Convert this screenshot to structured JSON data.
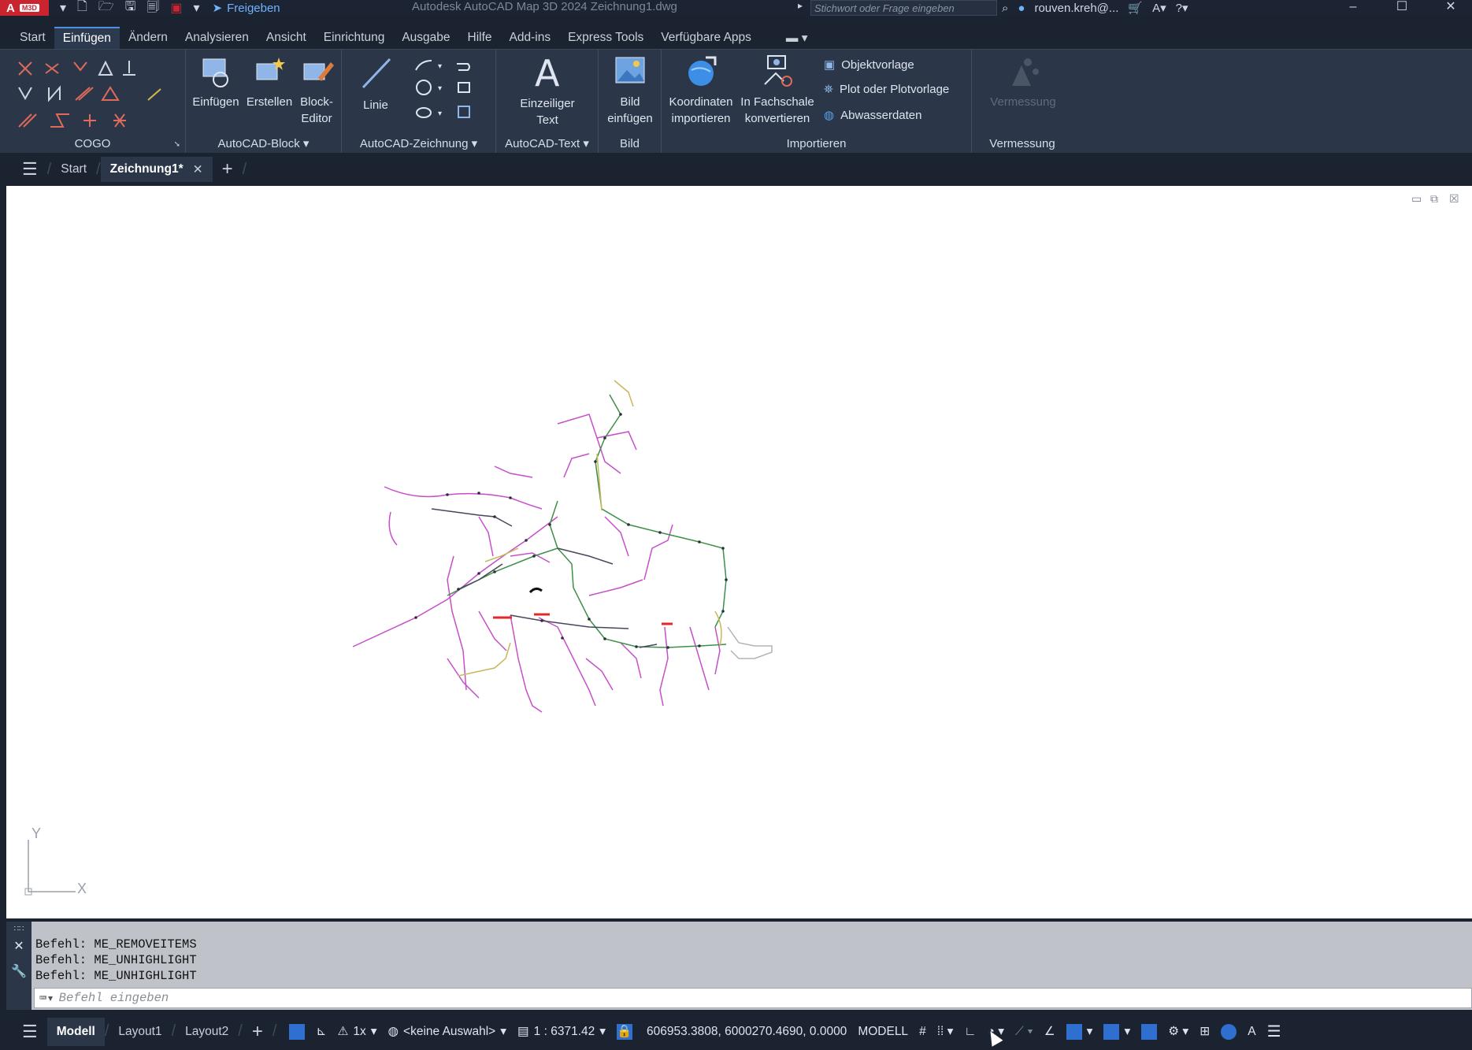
{
  "titlebar": {
    "logo_text": "A",
    "logo_badge": "M3D",
    "share_label": "Freigeben",
    "window_title": "Autodesk AutoCAD Map 3D 2024  Zeichnung1.dwg",
    "search_placeholder": "Stichwort oder Frage eingeben",
    "user": "rouven.kreh@..."
  },
  "menu": {
    "tabs": [
      "Start",
      "Einfügen",
      "Ändern",
      "Analysieren",
      "Ansicht",
      "Einrichtung",
      "Ausgabe",
      "Hilfe",
      "Add-ins",
      "Express Tools",
      "Verfügbare Apps"
    ],
    "active": "Einfügen"
  },
  "ribbon": {
    "cogo": {
      "title": "COGO"
    },
    "block": {
      "title": "AutoCAD-Block",
      "einfuegen": "Einfügen",
      "erstellen": "Erstellen",
      "block": "Block-",
      "editor": "Editor"
    },
    "zeichnung": {
      "title": "AutoCAD-Zeichnung",
      "linie": "Linie"
    },
    "text": {
      "title": "AutoCAD-Text",
      "einzeiliger": "Einzeiliger",
      "text": "Text"
    },
    "bild": {
      "title": "Bild",
      "bild": "Bild",
      "einfuegen": "einfügen"
    },
    "importieren": {
      "title": "Importieren",
      "koord1": "Koordinaten",
      "koord2": "importieren",
      "fach1": "In Fachschale",
      "fach2": "konvertieren",
      "objektvorlage": "Objektvorlage",
      "plot": "Plot oder Plotvorlage",
      "abwasser": "Abwasserdaten"
    },
    "vermessung": {
      "title": "Vermessung",
      "button": "Vermessung"
    }
  },
  "doctabs": {
    "start": "Start",
    "drawing": "Zeichnung1*"
  },
  "ucs": {
    "y": "Y",
    "x": "X"
  },
  "command": {
    "history": [
      "Befehl: ME_REMOVEITEMS",
      "Befehl: ME_UNHIGHLIGHT",
      "Befehl: ME_UNHIGHLIGHT"
    ],
    "placeholder": "Befehl eingeben"
  },
  "status": {
    "modell": "Modell",
    "layout1": "Layout1",
    "layout2": "Layout2",
    "scale_factor": "1x",
    "coord_system": "<keine Auswahl>",
    "scale": "1 : 6371.42",
    "coordinates": "606953.3808, 6000270.4690, 0.0000",
    "space": "MODELL"
  },
  "colors": {
    "accent": "#2f6fcf",
    "magenta_lines": "#c64fc9",
    "green_lines": "#3f8f4a",
    "yellow_lines": "#d6b74a",
    "red_marks": "#e02a2a"
  }
}
